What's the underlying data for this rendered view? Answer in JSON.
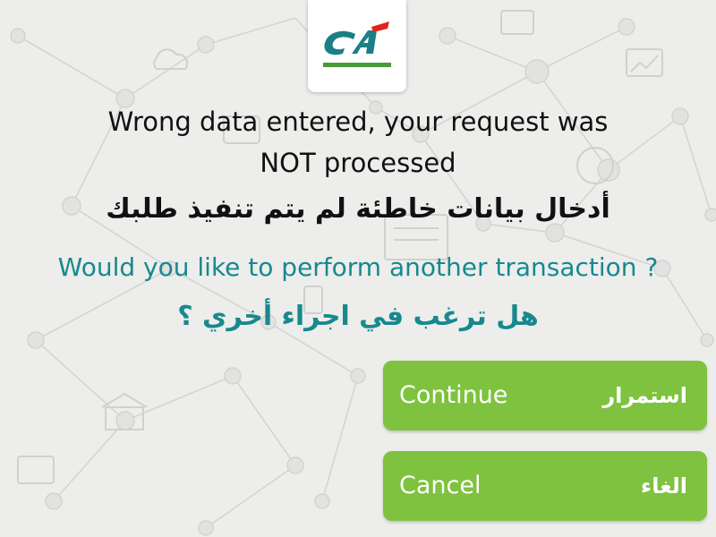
{
  "logo": {
    "icon": "credit-agricole-logo",
    "colors": {
      "teal": "#1b7f86",
      "green": "#4a9a3a",
      "red": "#e2231a"
    }
  },
  "message": {
    "english_line1": "Wrong data entered, your request was",
    "english_line2": "NOT processed",
    "arabic": "أدخال بيانات خاطئة لم يتم تنفيذ طلبك"
  },
  "question": {
    "english": "Would you like to perform another transaction ?",
    "arabic": "هل ترغب في اجراء أخري ؟"
  },
  "buttons": {
    "continue": {
      "english": "Continue",
      "arabic": "استمرار"
    },
    "cancel": {
      "english": "Cancel",
      "arabic": "الغاء"
    }
  },
  "theme": {
    "background": "#ededeb",
    "question_color": "#17898e",
    "button_color": "#7ec23f",
    "text_color": "#111111"
  }
}
